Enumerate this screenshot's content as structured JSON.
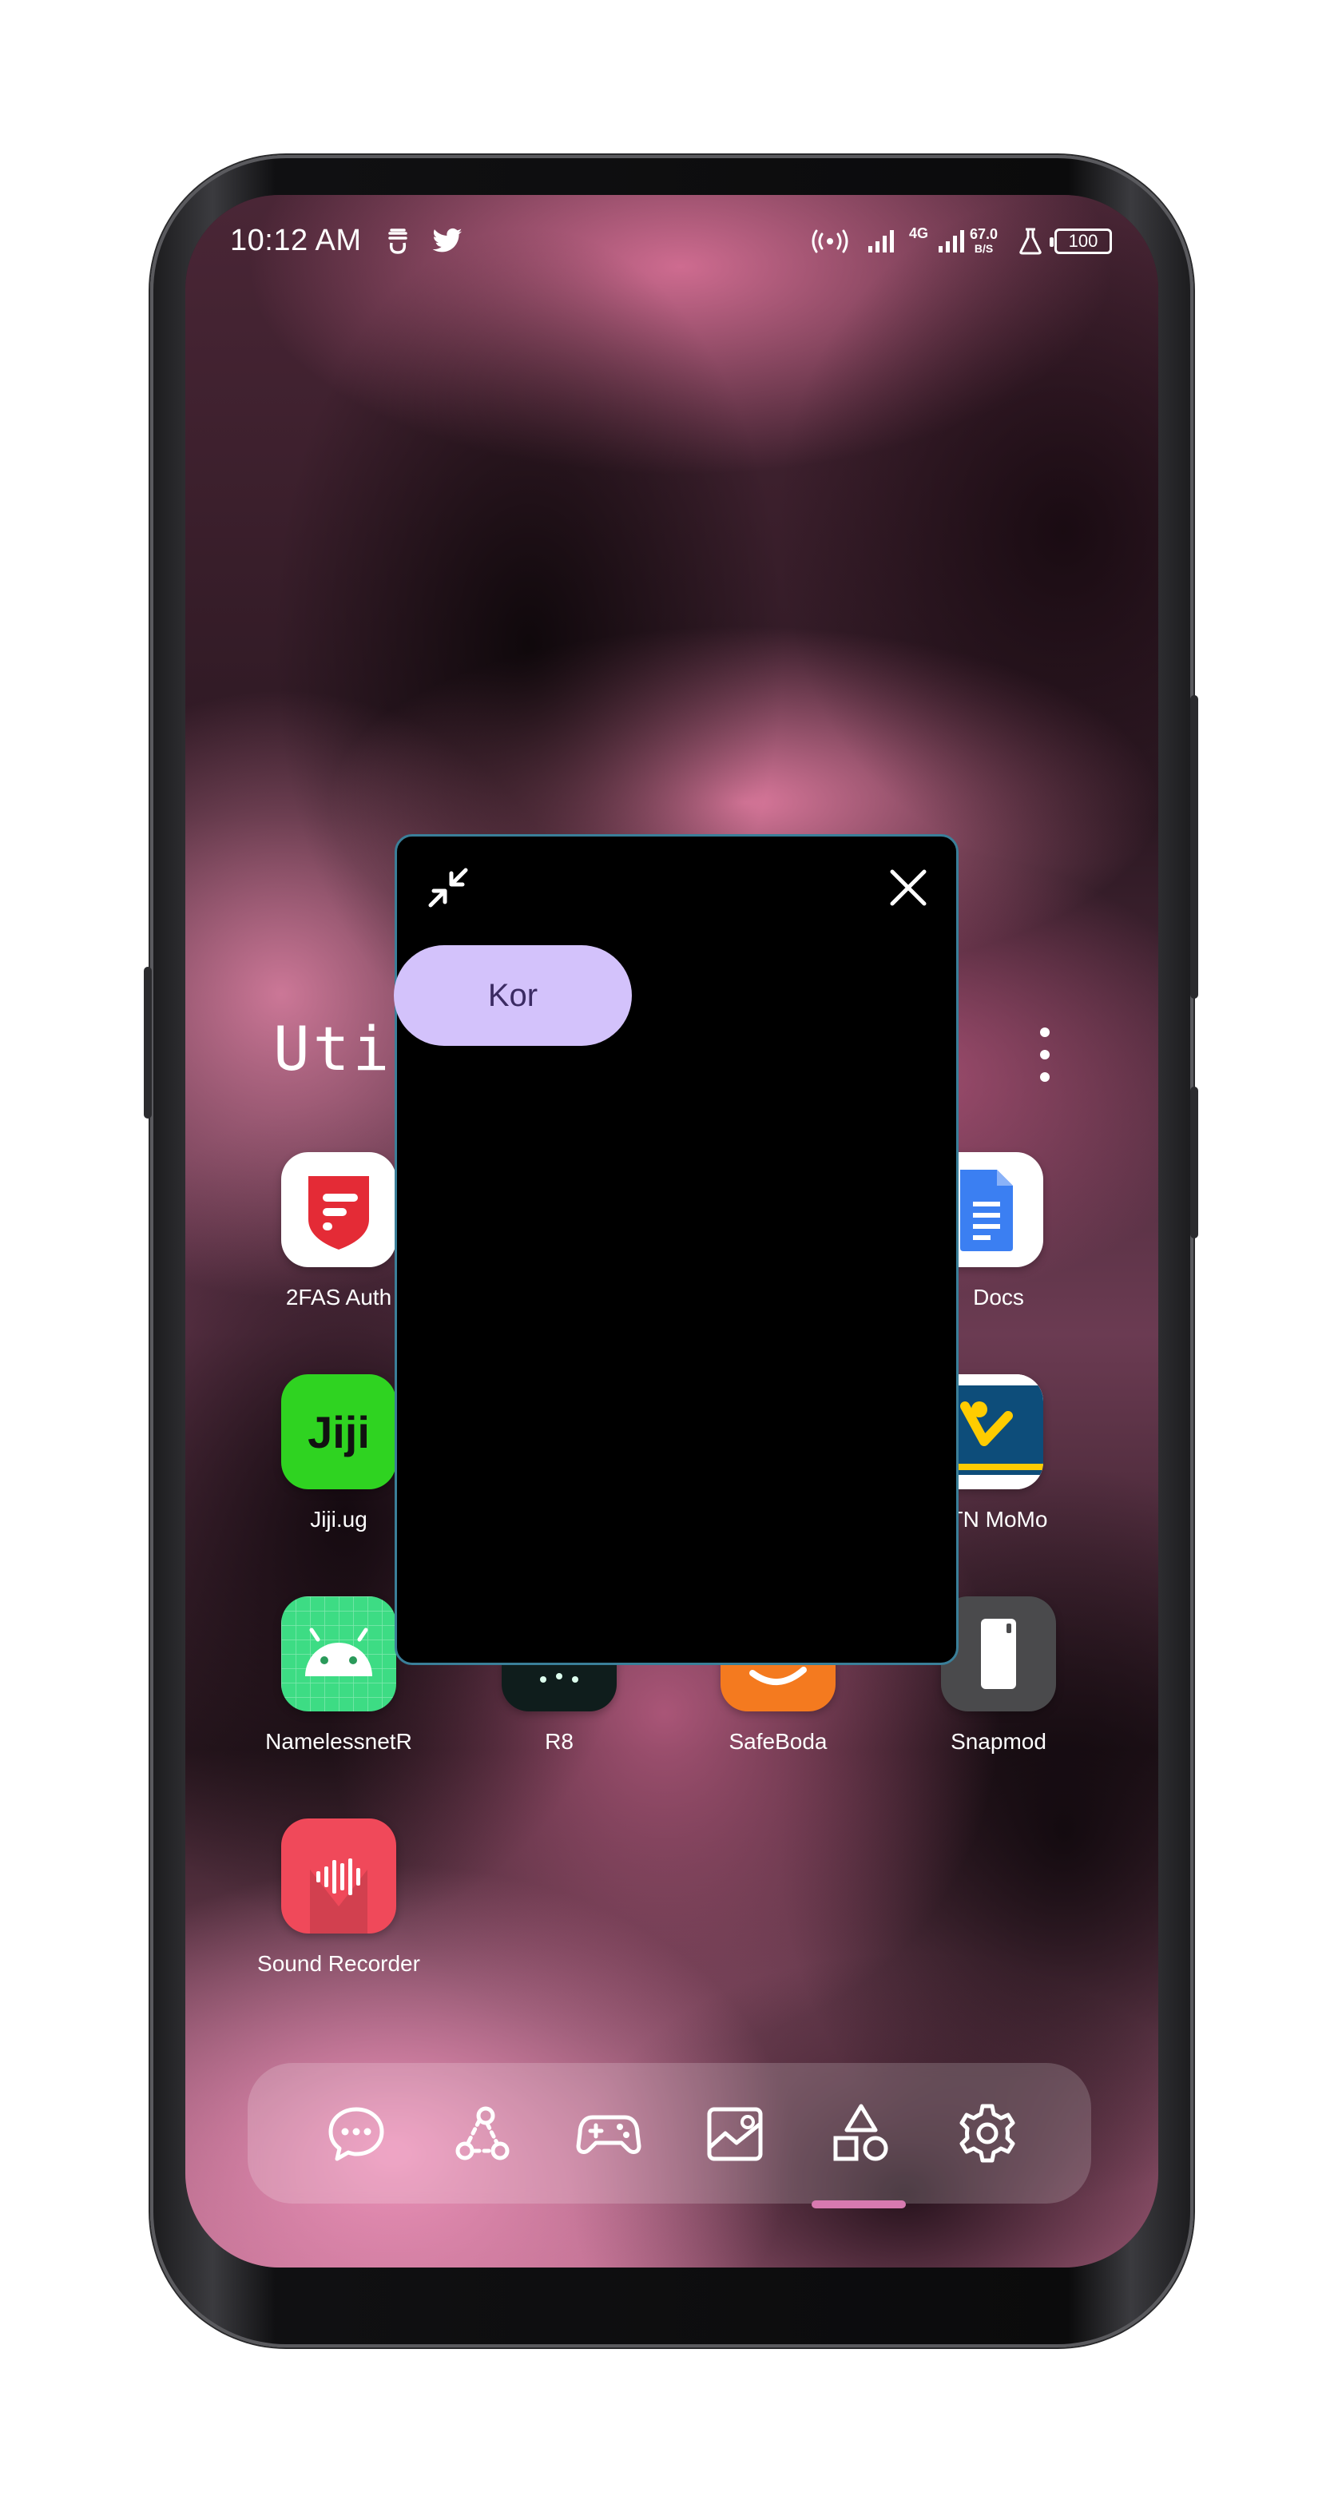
{
  "status_bar": {
    "time": "10:12 AM",
    "notification_icons": [
      "sync-icon",
      "twitter-icon"
    ],
    "network_type": "4G",
    "net_speed_value": "67.0",
    "net_speed_unit": "B/S",
    "battery": "100"
  },
  "folder": {
    "title": "Uti",
    "apps": [
      {
        "label": "2FAS Auth",
        "icon": "twofas-icon"
      },
      {
        "label": "Docs",
        "icon": "google-docs-icon"
      },
      {
        "label": "Jiji.ug",
        "icon": "jiji-icon"
      },
      {
        "label": "TN MoMo",
        "icon": "mtn-momo-icon"
      },
      {
        "label": "NamelessnetR",
        "icon": "android-icon"
      },
      {
        "label": "R8",
        "icon": "r8-icon"
      },
      {
        "label": "SafeBoda",
        "icon": "safeboda-icon"
      },
      {
        "label": "Snapmod",
        "icon": "snapmod-icon"
      },
      {
        "label": "Sound Recorder",
        "icon": "sound-recorder-icon"
      }
    ]
  },
  "floating_window": {
    "chip_label": "Kor"
  },
  "dock": {
    "items": [
      "chat-icon",
      "connections-icon",
      "gamepad-icon",
      "gallery-icon",
      "shapes-icon",
      "settings-icon"
    ],
    "active_index": 4
  },
  "colors": {
    "chip_bg": "#d3c2fb",
    "window_border": "#3a7f99",
    "dock_indicator": "#d77ab0"
  }
}
